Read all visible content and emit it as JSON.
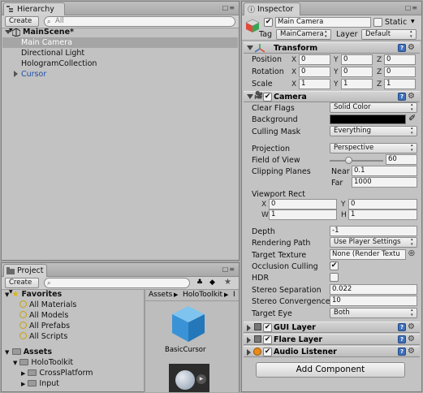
{
  "hierarchy": {
    "tab": "Hierarchy",
    "create": "Create",
    "search_placeholder": "All",
    "scene": "MainScene*",
    "items": [
      "Main Camera",
      "Directional Light",
      "HologramCollection",
      "Cursor"
    ]
  },
  "project": {
    "tab": "Project",
    "create": "Create",
    "favorites": {
      "label": "Favorites",
      "items": [
        "All Materials",
        "All Models",
        "All Prefabs",
        "All Scripts"
      ]
    },
    "assets": {
      "label": "Assets",
      "items": [
        "HoloToolkit",
        "CrossPlatform",
        "Input"
      ]
    },
    "breadcrumb": [
      "Assets",
      "HoloToolkit",
      "I"
    ],
    "asset_name": "BasicCursor"
  },
  "inspector": {
    "tab": "Inspector",
    "object_name": "Main Camera",
    "static_label": "Static",
    "tag_label": "Tag",
    "tag_value": "MainCamera",
    "layer_label": "Layer",
    "layer_value": "Default",
    "transform": {
      "title": "Transform",
      "rows": [
        {
          "label": "Position",
          "x": "0",
          "y": "0",
          "z": "0"
        },
        {
          "label": "Rotation",
          "x": "0",
          "y": "0",
          "z": "0"
        },
        {
          "label": "Scale",
          "x": "1",
          "y": "1",
          "z": "1"
        }
      ],
      "axis": [
        "X",
        "Y",
        "Z"
      ]
    },
    "camera": {
      "title": "Camera",
      "clear_flags": {
        "label": "Clear Flags",
        "value": "Solid Color"
      },
      "background": {
        "label": "Background",
        "color": "#000000"
      },
      "culling_mask": {
        "label": "Culling Mask",
        "value": "Everything"
      },
      "projection": {
        "label": "Projection",
        "value": "Perspective"
      },
      "fov": {
        "label": "Field of View",
        "value": "60",
        "level": 0.34
      },
      "clipping": {
        "label": "Clipping Planes",
        "near_label": "Near",
        "near": "0.1",
        "far_label": "Far",
        "far": "1000"
      },
      "viewport": {
        "label": "Viewport Rect",
        "x": "0",
        "y": "0",
        "w": "1",
        "h": "1",
        "x_label": "X",
        "y_label": "Y",
        "w_label": "W",
        "h_label": "H"
      },
      "depth": {
        "label": "Depth",
        "value": "-1"
      },
      "rendering_path": {
        "label": "Rendering Path",
        "value": "Use Player Settings"
      },
      "target_texture": {
        "label": "Target Texture",
        "value": "None (Render Textu"
      },
      "occlusion": {
        "label": "Occlusion Culling",
        "checked": "✔"
      },
      "hdr": {
        "label": "HDR",
        "checked": ""
      },
      "stereo_sep": {
        "label": "Stereo Separation",
        "value": "0.022"
      },
      "stereo_conv": {
        "label": "Stereo Convergence",
        "value": "10"
      },
      "target_eye": {
        "label": "Target Eye",
        "value": "Both"
      }
    },
    "components": [
      {
        "title": "GUI Layer"
      },
      {
        "title": "Flare Layer"
      },
      {
        "title": "Audio Listener"
      }
    ],
    "add_component": "Add Component"
  }
}
